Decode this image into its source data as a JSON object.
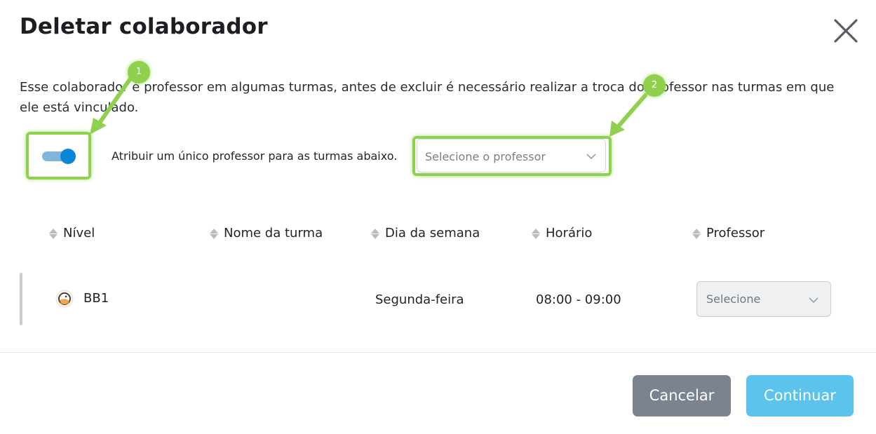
{
  "dialog": {
    "title": "Deletar colaborador",
    "description": "Esse colaborador é professor em algumas turmas, antes de excluir é necessário realizar a troca do professor nas turmas em que ele está vinculado."
  },
  "assign": {
    "toggle_on": true,
    "label": "Atribuir um único professor para as turmas abaixo.",
    "select_placeholder": "Selecione o professor"
  },
  "table": {
    "headers": [
      "Nível",
      "Nome da turma",
      "Dia da semana",
      "Horário",
      "Professor"
    ],
    "rows": [
      {
        "nivel": "BB1",
        "nome_turma": "",
        "dia": "Segunda-feira",
        "horario": "08:00 - 09:00",
        "professor_placeholder": "Selecione"
      }
    ]
  },
  "footer": {
    "cancel_label": "Cancelar",
    "continue_label": "Continuar"
  },
  "annotations": {
    "badge_1": "1",
    "badge_2": "2",
    "highlight_color": "#8fd14f"
  },
  "colors": {
    "toggle_accent": "#0a86d8",
    "cancel_bg": "#7b8390",
    "continue_bg": "#5bc3ec"
  }
}
